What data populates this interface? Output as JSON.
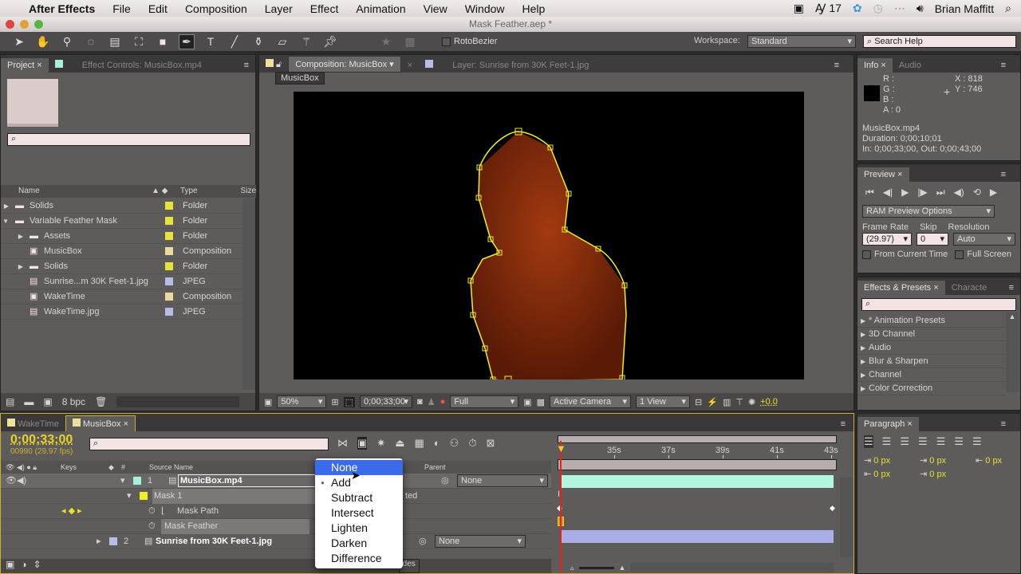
{
  "menubar": {
    "apple": "",
    "app": "After Effects",
    "items": [
      "File",
      "Edit",
      "Composition",
      "Layer",
      "Effect",
      "Animation",
      "View",
      "Window",
      "Help"
    ],
    "status": {
      "notifications": "17",
      "user": "Brian Maffitt"
    }
  },
  "window": {
    "title": "Mask Feather.aep *"
  },
  "toolbar": {
    "rotobezier": "RotoBezier",
    "workspace_label": "Workspace:",
    "workspace": "Standard",
    "search_help": "Search Help"
  },
  "project": {
    "tab": "Project",
    "tab2": "Effect Controls: MusicBox.mp4",
    "search": "",
    "columns": {
      "name": "Name",
      "type": "Type",
      "size": "Size"
    },
    "items": [
      {
        "name": "Solids",
        "type": "Folder",
        "label": "#e8e23a",
        "indent": 0,
        "toggle": "▶",
        "icon": "folder"
      },
      {
        "name": "Variable Feather Mask",
        "type": "Folder",
        "label": "#e8e23a",
        "indent": 0,
        "toggle": "▼",
        "icon": "folder"
      },
      {
        "name": "Assets",
        "type": "Folder",
        "label": "#e8e23a",
        "indent": 1,
        "toggle": "▶",
        "icon": "folder"
      },
      {
        "name": "MusicBox",
        "type": "Composition",
        "label": "#ead9a0",
        "indent": 1,
        "toggle": "",
        "icon": "composition"
      },
      {
        "name": "Solids",
        "type": "Folder",
        "label": "#e8e23a",
        "indent": 1,
        "toggle": "▶",
        "icon": "folder"
      },
      {
        "name": "Sunrise...m 30K Feet-1.jpg",
        "type": "JPEG",
        "label": "#b8bde8",
        "indent": 1,
        "toggle": "",
        "icon": "image"
      },
      {
        "name": "WakeTime",
        "type": "Composition",
        "label": "#ead9a0",
        "indent": 1,
        "toggle": "",
        "icon": "composition"
      },
      {
        "name": "WakeTime.jpg",
        "type": "JPEG",
        "label": "#b8bde8",
        "indent": 1,
        "toggle": "",
        "icon": "image"
      }
    ],
    "bpc": "8 bpc"
  },
  "comp": {
    "tab": "Composition: MusicBox",
    "layer_tab": "Layer: Sunrise from 30K Feet-1.jpg",
    "breadcrumb": "MusicBox",
    "zoom": "50%",
    "time": "0;00;33;00",
    "resolution": "Full",
    "camera": "Active Camera",
    "views": "1 View",
    "exposure": "+0.0"
  },
  "info": {
    "tab": "Info",
    "tab2": "Audio",
    "r": "R :",
    "g": "G :",
    "b": "B :",
    "a": "A : 0",
    "x": "X : 818",
    "y": "Y : 746",
    "name": "MusicBox.mp4",
    "duration": "Duration: 0;00;10;01",
    "inout": "In: 0;00;33;00, Out: 0;00;43;00"
  },
  "preview": {
    "tab": "Preview",
    "ram": "RAM Preview Options",
    "frame_rate_label": "Frame Rate",
    "skip_label": "Skip",
    "resolution_label": "Resolution",
    "frame_rate": "(29.97)",
    "skip": "0",
    "resolution": "Auto",
    "from_current": "From Current Time",
    "full_screen": "Full Screen"
  },
  "effects": {
    "tab": "Effects & Presets",
    "tab2": "Characte",
    "search": "",
    "items": [
      "* Animation Presets",
      "3D Channel",
      "Audio",
      "Blur & Sharpen",
      "Channel",
      "Color Correction"
    ]
  },
  "paragraph": {
    "tab": "Paragraph",
    "values": [
      "0 px",
      "0 px",
      "0 px",
      "0 px",
      "0 px"
    ]
  },
  "timeline": {
    "tabs": [
      "WakeTime",
      "MusicBox"
    ],
    "timecode": "0;00;33;00",
    "frames": "00990 (29.97 fps)",
    "search": "",
    "columns": {
      "keys": "Keys",
      "num": "#",
      "source": "Source Name",
      "parent": "Parent"
    },
    "layers": [
      {
        "num": "1",
        "name": "MusicBox.mp4",
        "label": "#a8f0dc",
        "parent": "None"
      },
      {
        "num": "2",
        "name": "Sunrise from 30K Feet-1.jpg",
        "label": "#b8bde8",
        "parent": "None"
      }
    ],
    "mask": {
      "name": "Mask 1",
      "path": "Mask Path",
      "feather": "Mask Feather",
      "mode_partial": "ted"
    },
    "ruler": [
      "35s",
      "37s",
      "39s",
      "41s",
      "43s"
    ],
    "bottom_partial": "des",
    "bars": {
      "layer1": "#b2f5e1",
      "layer2": "#a9aee6"
    }
  },
  "mask_mode_menu": {
    "options": [
      "None",
      "Add",
      "Subtract",
      "Intersect",
      "Lighten",
      "Darken",
      "Difference"
    ],
    "highlighted": "None",
    "checked": "Add"
  }
}
